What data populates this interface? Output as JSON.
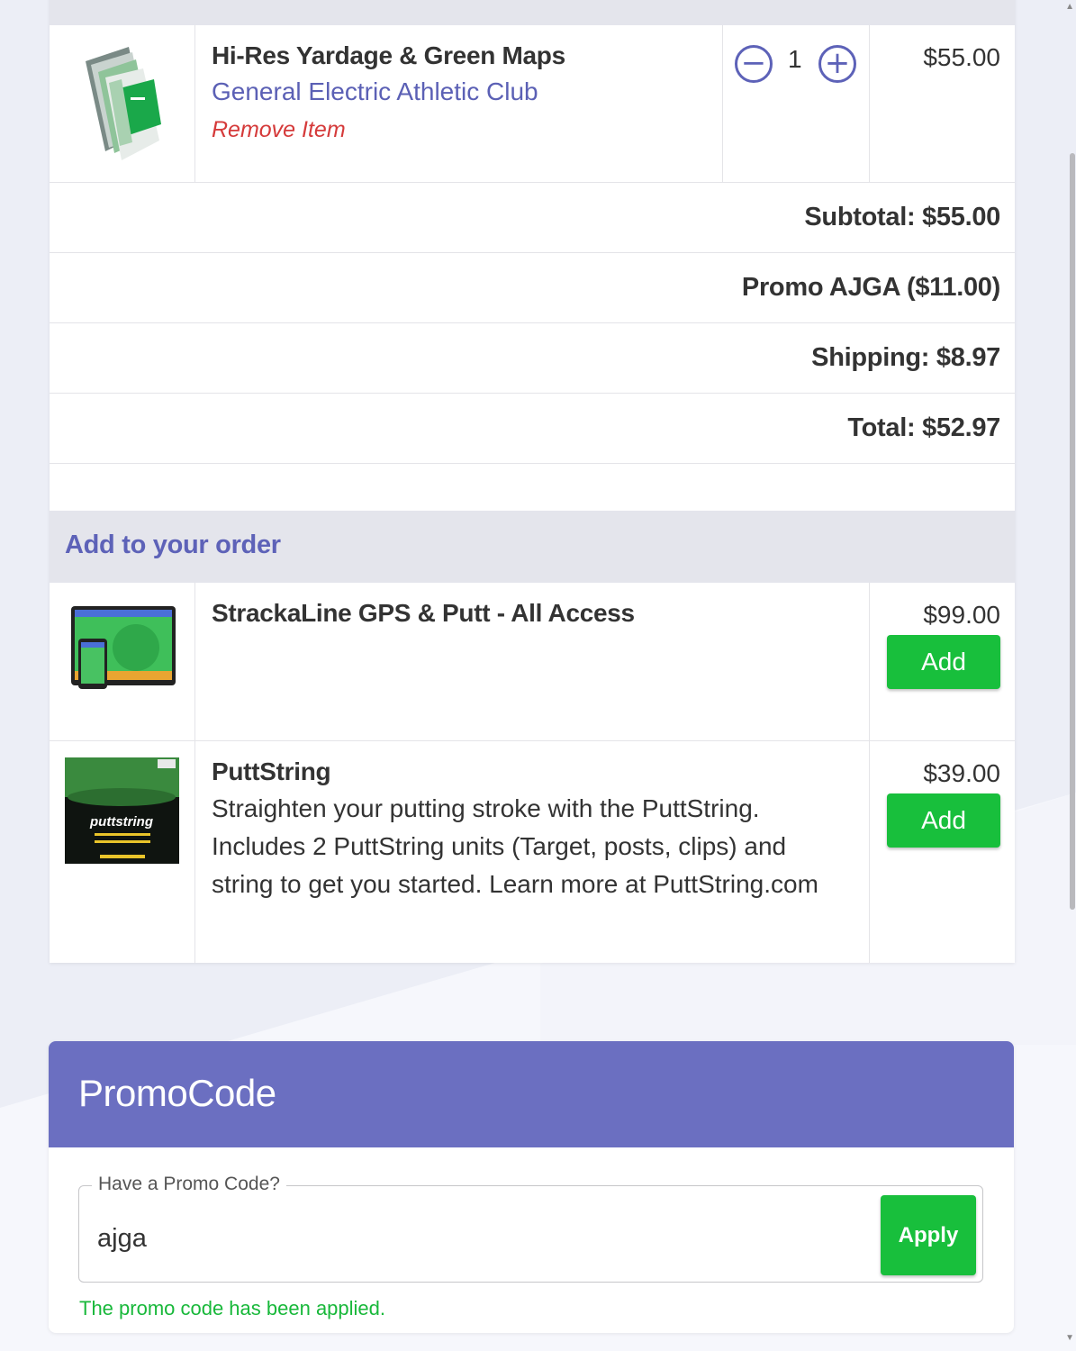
{
  "cart": {
    "item": {
      "title": "Hi-Res Yardage & Green Maps",
      "subtitle": "General Electric Athletic Club",
      "remove_label": "Remove Item",
      "quantity": "1",
      "price": "$55.00",
      "thumbnail_icon": "yardage-book-image"
    },
    "summary": {
      "subtotal": "Subtotal: $55.00",
      "promo": "Promo AJGA ($11.00)",
      "shipping": "Shipping: $8.97",
      "total": "Total: $52.97"
    }
  },
  "upsell": {
    "header": "Add to your order",
    "items": [
      {
        "title": "StrackaLine GPS & Putt - All Access",
        "description": "",
        "price": "$99.00",
        "add_label": "Add",
        "thumbnail_icon": "gps-devices-image"
      },
      {
        "title": "PuttString",
        "description": "Straighten your putting stroke with the PuttString. Includes 2 PuttString units (Target, posts, clips) and string to get you started. Learn more at PuttString.com",
        "price": "$39.00",
        "add_label": "Add",
        "thumbnail_icon": "puttstring-box-image",
        "thumbnail_text": "puttstring"
      }
    ]
  },
  "promo": {
    "header": "PromoCode",
    "field_label": "Have a Promo Code?",
    "field_value": "ajga",
    "apply_label": "Apply",
    "success_message": "The promo code has been applied."
  },
  "colors": {
    "accent": "#6b6fc1",
    "link": "#5b60b5",
    "danger": "#d53a3a",
    "success": "#18bf3c"
  }
}
